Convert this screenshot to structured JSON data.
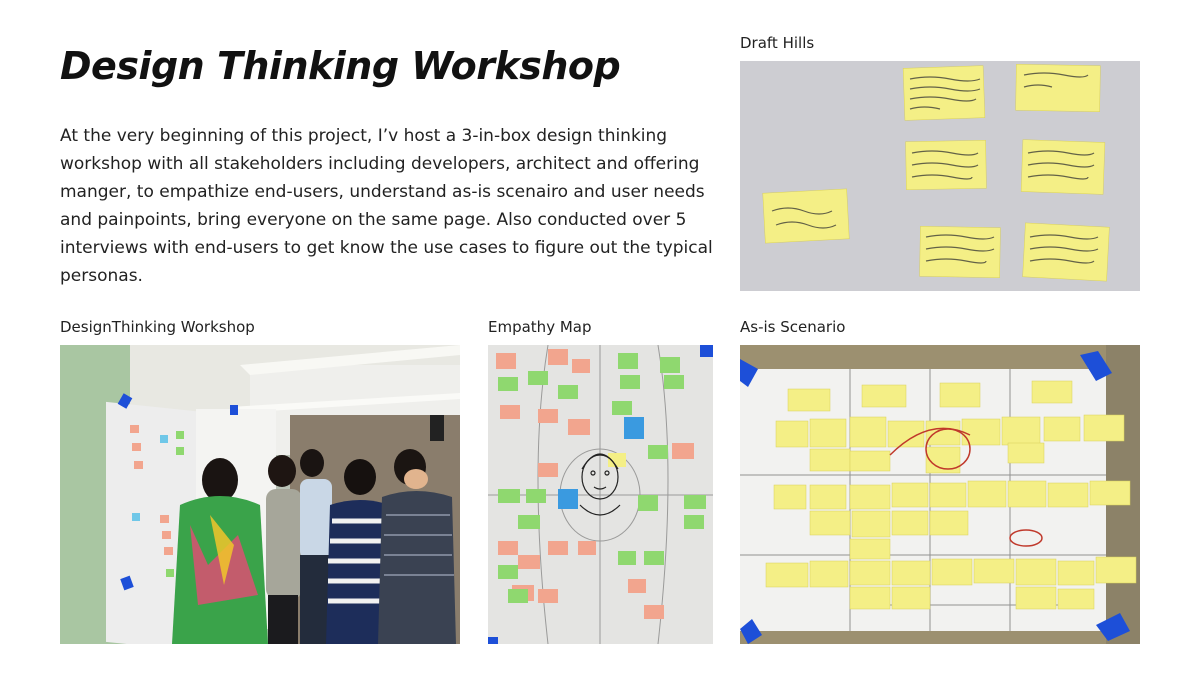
{
  "title": "Design Thinking Workshop",
  "intro": "At the very beginning of this project, I’v host a 3-in-box design thinking workshop with all stakeholders including developers, architect and offering manger, to empathize end-users, understand as-is scenairo and user needs and painpoints, bring everyone on the same page. Also conducted over 5 interviews with end-users to get know the use cases to figure out the typical personas.",
  "captions": {
    "draft_hills": "Draft Hills",
    "workshop": "DesignThinking Workshop",
    "empathy": "Empathy Map",
    "scenario": "As-is Scenario"
  },
  "colors": {
    "sticky_yellow": "#f4ef86",
    "sticky_pink": "#f2a58e",
    "sticky_green": "#8fd86f",
    "sticky_blue": "#3a9ae0",
    "tape_blue": "#1d4fd8",
    "board_gray": "#d4d4d8"
  }
}
